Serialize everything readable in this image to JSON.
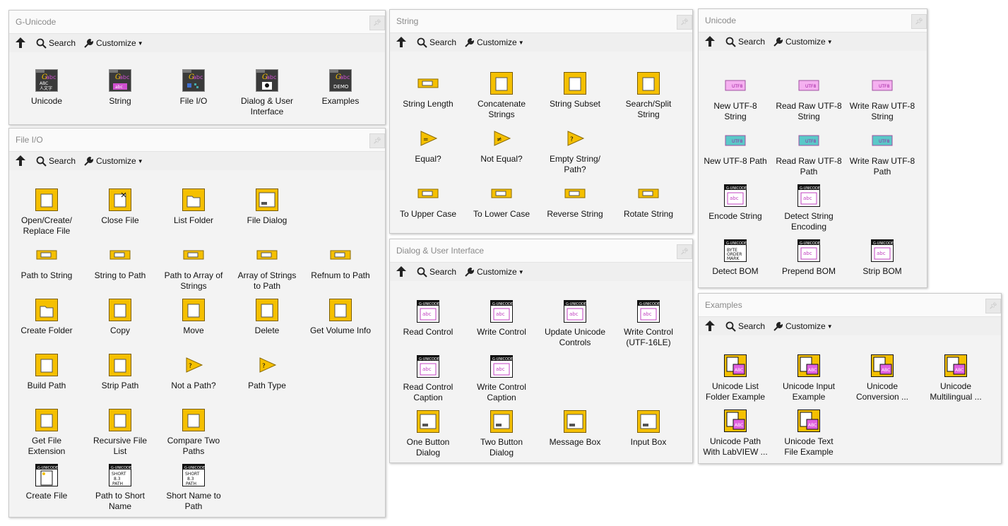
{
  "palettes": {
    "gunicode": {
      "title": "G-Unicode",
      "search": "Search",
      "customize": "Customize",
      "items": [
        {
          "label": "Unicode",
          "icon": "folder-unicode-icon"
        },
        {
          "label": "String",
          "icon": "folder-string-icon"
        },
        {
          "label": "File I/O",
          "icon": "folder-file-io-icon"
        },
        {
          "label": "Dialog & User\nInterface",
          "icon": "folder-dialog-icon"
        },
        {
          "label": "Examples",
          "icon": "folder-examples-icon"
        }
      ]
    },
    "fileio": {
      "title": "File I/O",
      "search": "Search",
      "customize": "Customize",
      "items": [
        {
          "label": "Open/Create/\nReplace File",
          "icon": "open-file-icon"
        },
        {
          "label": "Close File",
          "icon": "close-file-icon"
        },
        {
          "label": "List Folder",
          "icon": "list-folder-icon"
        },
        {
          "label": "File Dialog",
          "icon": "file-dialog-icon"
        },
        {
          "label": "Path to String",
          "icon": "path-to-string-icon"
        },
        {
          "label": "String to Path",
          "icon": "string-to-path-icon"
        },
        {
          "label": "Path to Array of\nStrings",
          "icon": "path-to-array-icon"
        },
        {
          "label": "Array of Strings\nto Path",
          "icon": "array-to-path-icon"
        },
        {
          "label": "Refnum to Path",
          "icon": "refnum-to-path-icon"
        },
        {
          "label": "Create Folder",
          "icon": "create-folder-icon"
        },
        {
          "label": "Copy",
          "icon": "copy-icon"
        },
        {
          "label": "Move",
          "icon": "move-icon"
        },
        {
          "label": "Delete",
          "icon": "delete-icon"
        },
        {
          "label": "Get Volume Info",
          "icon": "volume-info-icon"
        },
        {
          "label": "Build Path",
          "icon": "build-path-icon"
        },
        {
          "label": "Strip Path",
          "icon": "strip-path-icon"
        },
        {
          "label": "Not a Path?",
          "icon": "not-a-path-icon"
        },
        {
          "label": "Path Type",
          "icon": "path-type-icon"
        },
        {
          "label": "Get File\nExtension",
          "icon": "file-extension-icon"
        },
        {
          "label": "Recursive File\nList",
          "icon": "recursive-list-icon"
        },
        {
          "label": "Compare Two\nPaths",
          "icon": "compare-paths-icon"
        },
        {
          "label": "Create File",
          "icon": "create-file-icon"
        },
        {
          "label": "Path to Short\nName",
          "icon": "path-to-short-icon"
        },
        {
          "label": "Short Name to\nPath",
          "icon": "short-to-path-icon"
        }
      ]
    },
    "string": {
      "title": "String",
      "search": "Search",
      "customize": "Customize",
      "items": [
        {
          "label": "String Length",
          "icon": "string-length-icon"
        },
        {
          "label": "Concatenate\nStrings",
          "icon": "concatenate-icon"
        },
        {
          "label": "String Subset",
          "icon": "string-subset-icon"
        },
        {
          "label": "Search/Split\nString",
          "icon": "search-split-icon"
        },
        {
          "label": "Equal?",
          "icon": "equal-icon"
        },
        {
          "label": "Not Equal?",
          "icon": "not-equal-icon"
        },
        {
          "label": "Empty String/\nPath?",
          "icon": "empty-string-icon"
        },
        {
          "label": "To Upper Case",
          "icon": "upper-case-icon"
        },
        {
          "label": "To Lower Case",
          "icon": "lower-case-icon"
        },
        {
          "label": "Reverse String",
          "icon": "reverse-string-icon"
        },
        {
          "label": "Rotate String",
          "icon": "rotate-string-icon"
        }
      ]
    },
    "dialog": {
      "title": "Dialog & User Interface",
      "search": "Search",
      "customize": "Customize",
      "items": [
        {
          "label": "Read Control",
          "icon": "read-control-icon"
        },
        {
          "label": "Write Control",
          "icon": "write-control-icon"
        },
        {
          "label": "Update Unicode\nControls",
          "icon": "update-controls-icon"
        },
        {
          "label": "Write Control\n(UTF-16LE)",
          "icon": "write-utf16-icon"
        },
        {
          "label": "Read Control\nCaption",
          "icon": "read-caption-icon"
        },
        {
          "label": "Write Control\nCaption",
          "icon": "write-caption-icon"
        },
        {
          "label": "One Button\nDialog",
          "icon": "one-button-icon"
        },
        {
          "label": "Two Button\nDialog",
          "icon": "two-button-icon"
        },
        {
          "label": "Message Box",
          "icon": "message-box-icon"
        },
        {
          "label": "Input Box",
          "icon": "input-box-icon"
        }
      ]
    },
    "unicode": {
      "title": "Unicode",
      "search": "Search",
      "customize": "Customize",
      "items": [
        {
          "label": "New UTF-8\nString",
          "icon": "new-utf8-string-icon"
        },
        {
          "label": "Read Raw UTF-8\nString",
          "icon": "read-raw-string-icon"
        },
        {
          "label": "Write Raw UTF-8\nString",
          "icon": "write-raw-string-icon"
        },
        {
          "label": "New UTF-8 Path",
          "icon": "new-utf8-path-icon"
        },
        {
          "label": "Read Raw UTF-8\nPath",
          "icon": "read-raw-path-icon"
        },
        {
          "label": "Write Raw UTF-8\nPath",
          "icon": "write-raw-path-icon"
        },
        {
          "label": "Encode String",
          "icon": "encode-string-icon"
        },
        {
          "label": "Detect String\nEncoding",
          "icon": "detect-encoding-icon"
        },
        {
          "label": "Detect BOM",
          "icon": "detect-bom-icon"
        },
        {
          "label": "Prepend BOM",
          "icon": "prepend-bom-icon"
        },
        {
          "label": "Strip BOM",
          "icon": "strip-bom-icon"
        }
      ]
    },
    "examples": {
      "title": "Examples",
      "search": "Search",
      "customize": "Customize",
      "items": [
        {
          "label": "Unicode List\nFolder Example",
          "icon": "list-folder-example-icon"
        },
        {
          "label": "Unicode Input\nExample",
          "icon": "input-example-icon"
        },
        {
          "label": "Unicode\nConversion ...",
          "icon": "conversion-example-icon"
        },
        {
          "label": "Unicode\nMultilingual ...",
          "icon": "multilingual-example-icon"
        },
        {
          "label": "Unicode Path\nWith LabVIEW ...",
          "icon": "path-example-icon"
        },
        {
          "label": "Unicode Text\nFile Example",
          "icon": "text-file-example-icon"
        }
      ]
    }
  }
}
